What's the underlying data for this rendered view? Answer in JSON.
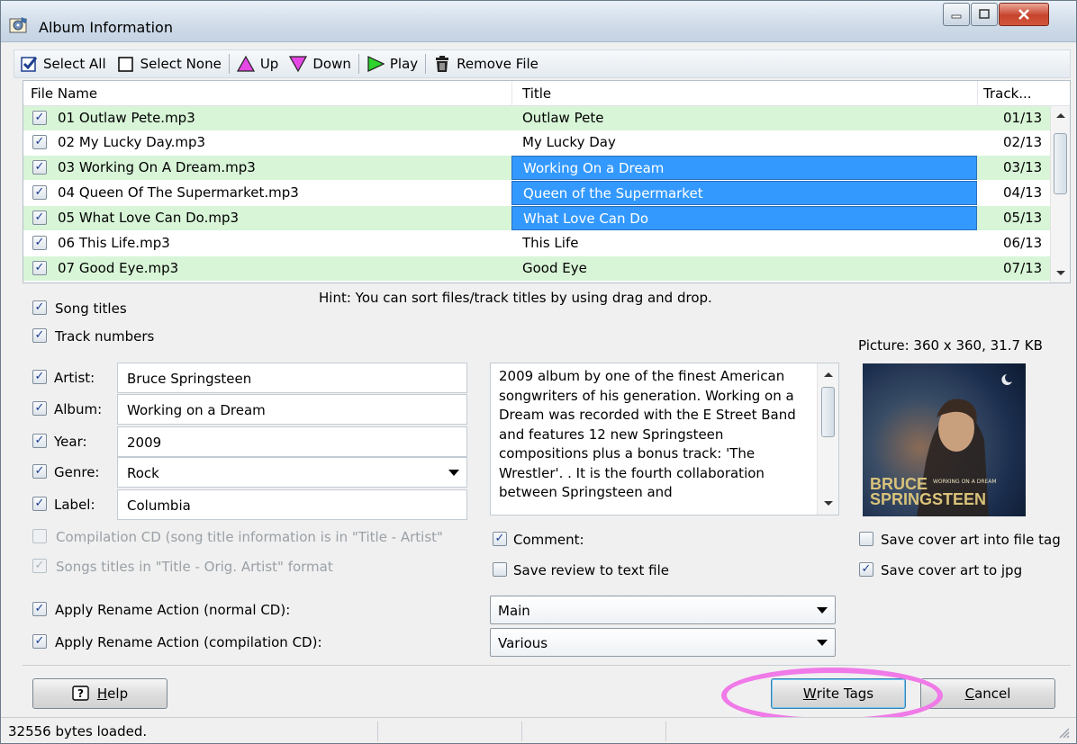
{
  "window": {
    "title": "Album Information"
  },
  "toolbar": {
    "select_all": "Select All",
    "select_none": "Select None",
    "up": "Up",
    "down": "Down",
    "play": "Play",
    "remove_file": "Remove File"
  },
  "filelist": {
    "columns": [
      "File Name",
      "Title",
      "Track..."
    ],
    "rows": [
      {
        "file": "01 Outlaw Pete.mp3",
        "title": "Outlaw Pete",
        "track": "01/13",
        "checked": true,
        "selected": false
      },
      {
        "file": "02 My Lucky Day.mp3",
        "title": "My Lucky Day",
        "track": "02/13",
        "checked": true,
        "selected": false
      },
      {
        "file": "03 Working On A Dream.mp3",
        "title": "Working On a Dream",
        "track": "03/13",
        "checked": true,
        "selected": true
      },
      {
        "file": "04 Queen Of The Supermarket.mp3",
        "title": "Queen of the Supermarket",
        "track": "04/13",
        "checked": true,
        "selected": true
      },
      {
        "file": "05 What Love Can Do.mp3",
        "title": "What Love Can Do",
        "track": "05/13",
        "checked": true,
        "selected": true
      },
      {
        "file": "06 This Life.mp3",
        "title": "This Life",
        "track": "06/13",
        "checked": true,
        "selected": false
      },
      {
        "file": "07 Good Eye.mp3",
        "title": "Good Eye",
        "track": "07/13",
        "checked": true,
        "selected": false
      }
    ]
  },
  "hint": "Hint: You can sort files/track titles by using drag and drop.",
  "options": {
    "song_titles": "Song titles",
    "track_numbers": "Track numbers"
  },
  "fields": {
    "artist_label": "Artist:",
    "artist_value": "Bruce Springsteen",
    "album_label": "Album:",
    "album_value": "Working on a Dream",
    "year_label": "Year:",
    "year_value": "2009",
    "genre_label": "Genre:",
    "genre_value": "Rock",
    "label_label": "Label:",
    "label_value": "Columbia"
  },
  "comment_text": "2009 album by one of the finest American songwriters of his generation. Working on a Dream was recorded with the E Street Band and features 12 new Springsteen compositions plus a bonus track: 'The Wrestler'. . It is the fourth collaboration between Springsteen and",
  "picture_info": "Picture: 360 x 360, 31.7 KB",
  "cover": {
    "title_line1": "BRUCE",
    "title_line2": "SPRINGSTEEN",
    "subtitle": "WORKING ON A DREAM"
  },
  "checks": {
    "compilation_cd": "Compilation CD (song title information is in \"Title - Artist\"",
    "songs_titles_format": "Songs titles in \"Title - Orig. Artist\" format",
    "comment": "Comment:",
    "save_review": "Save review to text file",
    "save_cover_tags": "Save cover art into file tag",
    "save_cover_jpg": "Save cover art to jpg"
  },
  "rename": {
    "normal_label": "Apply Rename Action (normal CD):",
    "normal_value": "Main",
    "compilation_label": "Apply Rename Action (compilation CD):",
    "compilation_value": "Various"
  },
  "buttons": {
    "help_prefix": "",
    "help_underline": "H",
    "help_rest": "elp",
    "write_underline": "W",
    "write_rest": "rite Tags",
    "cancel_underline": "C",
    "cancel_rest": "ancel"
  },
  "status": {
    "text": "32556 bytes loaded."
  },
  "colors": {
    "row_alt": "#d8f5d8",
    "selection": "#3399ff",
    "highlight_ring": "#f07ae8"
  }
}
